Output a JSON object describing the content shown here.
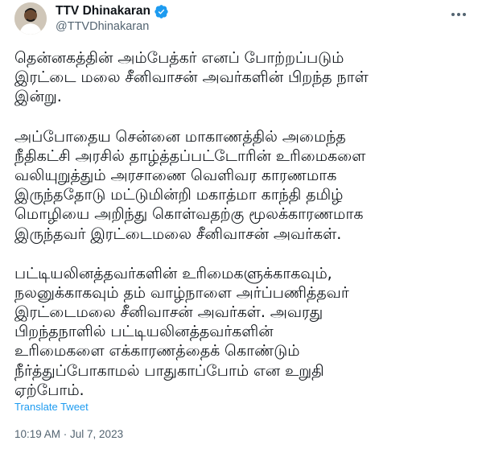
{
  "author": {
    "name": "TTV Dhinakaran",
    "handle": "@TTVDhinakaran",
    "verified_badge": "verified-badge-icon",
    "badge_color": "#1d9bf0"
  },
  "tweet": {
    "paragraphs": [
      [
        "தென்னகத்தின் அம்பேத்கர் எனப் போற்றப்படும்",
        "இரட்டை மலை சீனிவாசன் அவர்களின் பிறந்த நாள்",
        "இன்று."
      ],
      [
        "அப்போதைய சென்னை மாகாணத்தில் அமைந்த",
        "நீதிகட்சி அரசில் தாழ்த்தப்பட்டோரின் உரிமைகளை",
        "வலியுறுத்தும் அரசாணை வெளிவர காரணமாக",
        "இருந்ததோடு மட்டுமின்றி மகாத்மா காந்தி தமிழ்",
        "மொழியை அறிந்து கொள்வதற்கு மூலக்காரணமாக",
        "இருந்தவர் இரட்டைமலை சீனிவாசன் அவர்கள்."
      ],
      [
        "பட்டியலினத்தவர்களின் உரிமைகளுக்காகவும்,",
        "நலனுக்காகவும் தம் வாழ்நாளை அர்ப்பணித்தவர்",
        "இரட்டைமலை சீனிவாசன் அவர்கள். அவரது",
        "பிறந்தநாளில் பட்டியலினத்தவர்களின்",
        "உரிமைகளை எக்காரணத்தைக் கொண்டும்",
        "நீர்த்துப்போகாமல் பாதுகாப்போம் என உறுதி",
        "ஏற்போம்."
      ]
    ],
    "translate_label": "Translate Tweet",
    "timestamp": "10:19 AM · Jul 7, 2023"
  },
  "colors": {
    "text": "#0f1419",
    "secondary": "#536471",
    "link": "#1d9bf0"
  }
}
